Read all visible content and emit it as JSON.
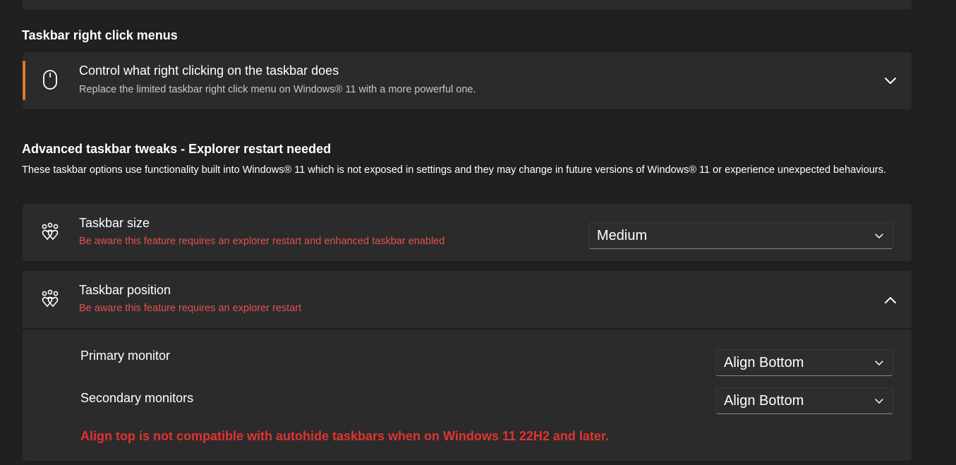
{
  "sections": {
    "right_click": {
      "title": "Taskbar right click menus",
      "card": {
        "icon": "mouse-icon",
        "title": "Control what right clicking on the taskbar does",
        "subtitle": "Replace the limited taskbar right click menu on Windows® 11 with a more powerful one.",
        "expanded": false
      }
    },
    "advanced": {
      "title": "Advanced taskbar tweaks - Explorer restart needed",
      "description": "These taskbar options use functionality built into Windows® 11 which is not exposed in settings and they may change in future versions of Windows® 11 or experience unexpected behaviours.",
      "size_card": {
        "icon": "hearts-icon",
        "title": "Taskbar size",
        "warning": "Be aware this feature requires an explorer restart and enhanced taskbar enabled",
        "value": "Medium"
      },
      "position_card": {
        "icon": "hearts-icon",
        "title": "Taskbar position",
        "warning": "Be aware this feature requires an explorer restart",
        "expanded": true,
        "primary_label": "Primary monitor",
        "primary_value": "Align Bottom",
        "secondary_label": "Secondary monitors",
        "secondary_value": "Align Bottom",
        "error": "Align top is not compatible with autohide taskbars when on Windows 11 22H2 and later."
      }
    }
  },
  "colors": {
    "background": "#202020",
    "card": "#2b2b2b",
    "accent": "#d97b2b",
    "warning_text": "#e0524f",
    "error_text": "#e2332f"
  }
}
